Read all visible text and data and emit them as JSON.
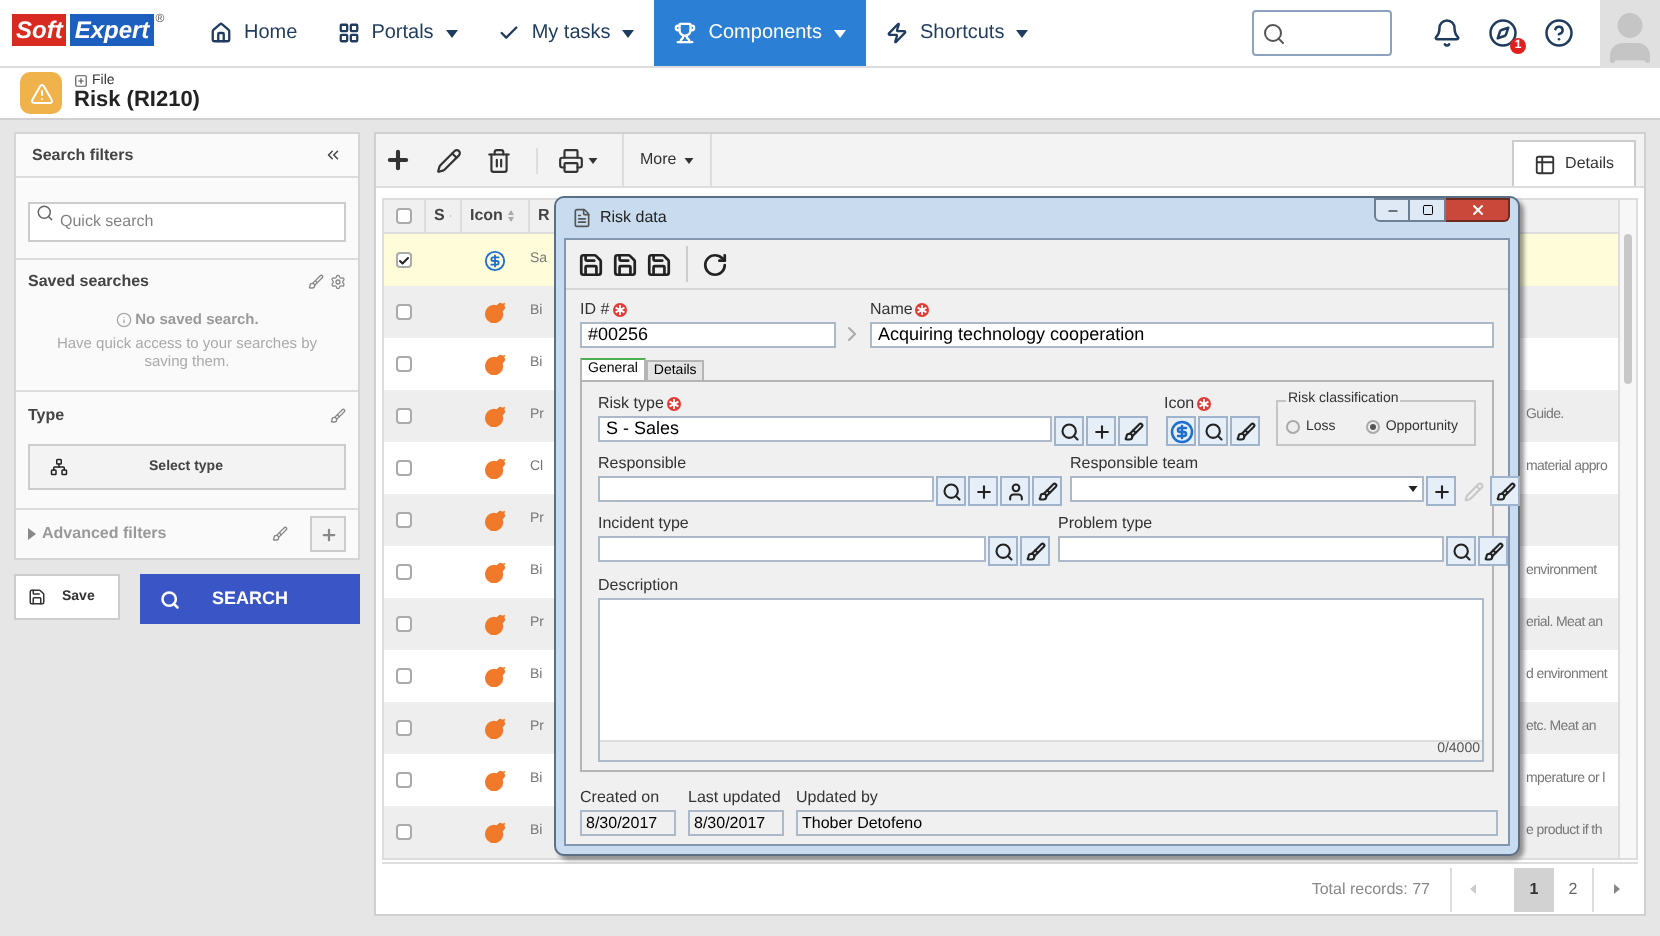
{
  "nav": {
    "logo": [
      "Soft",
      "Expert",
      "®"
    ],
    "items": [
      {
        "label": "Home",
        "kind": "home",
        "dropdown": false,
        "selected": false
      },
      {
        "label": "Portals",
        "kind": "grid",
        "dropdown": true,
        "selected": false
      },
      {
        "label": "My tasks",
        "kind": "check",
        "dropdown": true,
        "selected": false
      },
      {
        "label": "Components",
        "kind": "trophy",
        "dropdown": true,
        "selected": true
      },
      {
        "label": "Shortcuts",
        "kind": "bolt",
        "dropdown": true,
        "selected": false
      }
    ],
    "badge": "1"
  },
  "header": {
    "breadcrumb": "File",
    "title": "Risk (RI210)"
  },
  "filters": {
    "title": "Search filters",
    "quick_search": {
      "placeholder": "Quick search"
    },
    "saved_searches": {
      "title": "Saved searches",
      "empty_title": "No saved search.",
      "empty_text": "Have quick access to your searches by saving them."
    },
    "type": {
      "title": "Type",
      "button": "Select type"
    },
    "advanced": {
      "label": "Advanced filters",
      "expanded": false
    },
    "save_button": "Save",
    "search_button": "SEARCH"
  },
  "toolbar": {
    "more": "More",
    "details_tab": "Details"
  },
  "table": {
    "all_checked": false,
    "columns": [
      {
        "label": "S"
      },
      {
        "label": "Icon"
      },
      {
        "label": "R"
      }
    ],
    "rows": [
      {
        "checked": true,
        "selected": true,
        "kind": "dollar",
        "column_3": "Sa"
      },
      {
        "checked": false,
        "selected": false,
        "kind": "bomb",
        "column_3": "Bi"
      },
      {
        "checked": false,
        "selected": false,
        "kind": "bomb",
        "column_3": "Bi"
      },
      {
        "checked": false,
        "selected": false,
        "kind": "bomb",
        "column_3": "Pr",
        "column_4": "Guide."
      },
      {
        "checked": false,
        "selected": false,
        "kind": "bomb",
        "column_3": "Cl",
        "column_4": "material appro"
      },
      {
        "checked": false,
        "selected": false,
        "kind": "bomb",
        "column_3": "Pr"
      },
      {
        "checked": false,
        "selected": false,
        "kind": "bomb",
        "column_3": "Bi",
        "column_4": "environment"
      },
      {
        "checked": false,
        "selected": false,
        "kind": "bomb",
        "column_3": "Pr",
        "column_4": "erial. Meat an"
      },
      {
        "checked": false,
        "selected": false,
        "kind": "bomb",
        "column_3": "Bi",
        "column_4": "d environment"
      },
      {
        "checked": false,
        "selected": false,
        "kind": "bomb",
        "column_3": "Pr",
        "column_4": "etc. Meat an"
      },
      {
        "checked": false,
        "selected": false,
        "kind": "bomb",
        "column_3": "Bi",
        "column_4": "mperature or l"
      },
      {
        "checked": false,
        "selected": false,
        "kind": "bomb",
        "column_3": "Bi",
        "column_4": "e product if th"
      }
    ]
  },
  "pagination": {
    "total": "Total records: 77",
    "pages": [
      {
        "label": "1",
        "selected": true
      },
      {
        "label": "2",
        "selected": false
      }
    ]
  },
  "dialog": {
    "title": "Risk data",
    "id": {
      "label": "ID #",
      "value": "#00256",
      "required": true
    },
    "name": {
      "label": "Name",
      "value": "Acquiring technology cooperation",
      "required": true
    },
    "tabs": [
      {
        "label": "General",
        "selected": true
      },
      {
        "label": "Details",
        "selected": false
      }
    ],
    "risk_type": {
      "label": "Risk type",
      "value": "S - Sales",
      "required": true,
      "buttons": [
        {
          "kind": "search",
          "disabled": false
        },
        {
          "kind": "plus",
          "disabled": false
        },
        {
          "kind": "erase",
          "disabled": false
        }
      ]
    },
    "icon_field": {
      "label": "Icon",
      "required": true,
      "buttons": [
        {
          "kind": "dollar",
          "disabled": false
        },
        {
          "kind": "search",
          "disabled": false
        },
        {
          "kind": "erase",
          "disabled": false
        }
      ]
    },
    "classification": {
      "label": "Risk classification",
      "options": [
        {
          "label": "Loss",
          "selected": false
        },
        {
          "label": "Opportunity",
          "selected": true
        }
      ]
    },
    "responsible": {
      "label": "Responsible",
      "buttons": [
        {
          "kind": "search",
          "disabled": false
        },
        {
          "kind": "plus",
          "disabled": false
        },
        {
          "kind": "user",
          "disabled": false
        },
        {
          "kind": "erase",
          "disabled": false
        }
      ]
    },
    "responsible_team": {
      "label": "Responsible team",
      "buttons": [
        {
          "kind": "plus",
          "disabled": false
        },
        {
          "kind": "edit",
          "disabled": true
        },
        {
          "kind": "erase",
          "disabled": false
        }
      ]
    },
    "incident_type": {
      "label": "Incident type",
      "buttons": [
        {
          "kind": "search",
          "disabled": false
        },
        {
          "kind": "erase",
          "disabled": false
        }
      ]
    },
    "problem_type": {
      "label": "Problem type",
      "buttons": [
        {
          "kind": "search",
          "disabled": false
        },
        {
          "kind": "erase",
          "disabled": false
        }
      ]
    },
    "description": {
      "label": "Description",
      "counter": "0/4000"
    },
    "created_on": {
      "label": "Created on",
      "value": "8/30/2017"
    },
    "last_updated": {
      "label": "Last updated",
      "value": "8/30/2017"
    },
    "updated_by": {
      "label": "Updated by",
      "value": "Thober Detofeno"
    }
  }
}
